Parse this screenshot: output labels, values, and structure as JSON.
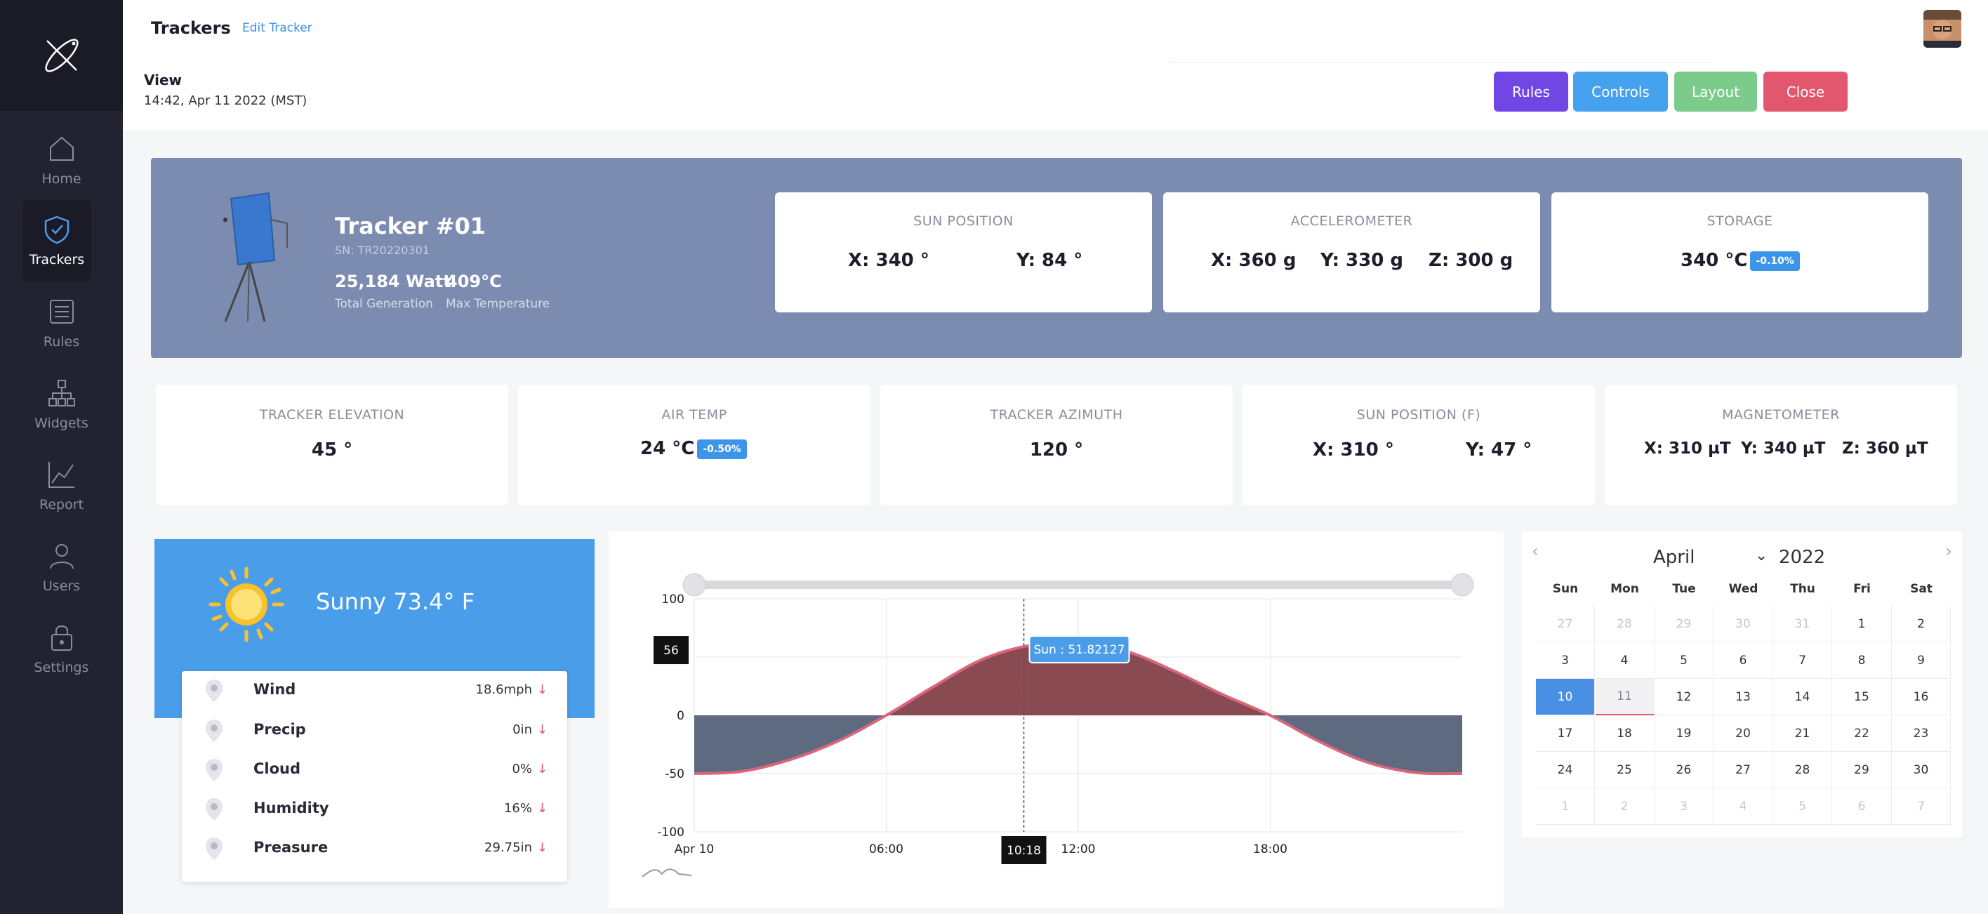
{
  "sidebar": {
    "items": [
      {
        "label": "Home",
        "icon": "home-icon"
      },
      {
        "label": "Trackers",
        "icon": "shield-check-icon"
      },
      {
        "label": "Rules",
        "icon": "list-icon"
      },
      {
        "label": "Widgets",
        "icon": "hierarchy-icon"
      },
      {
        "label": "Report",
        "icon": "trend-icon"
      },
      {
        "label": "Users",
        "icon": "user-icon"
      },
      {
        "label": "Settings",
        "icon": "lock-icon"
      }
    ],
    "active": "Trackers"
  },
  "header": {
    "title": "Trackers",
    "edit_link": "Edit Tracker",
    "view_label": "View",
    "timestamp": "14:42, Apr 11 2022 (MST)",
    "buttons": {
      "rules": "Rules",
      "controls": "Controls",
      "layout": "Layout",
      "close": "Close"
    }
  },
  "tracker": {
    "name": "Tracker #01",
    "serial": "SN: TR20220301",
    "generation": "25,184 Watt",
    "max_temp": "409°C",
    "generation_label": "Total Generation",
    "max_temp_label": "Max Temperature"
  },
  "top_cards": {
    "sun_position": {
      "title": "SUN POSITION",
      "x": "X:  340 °",
      "y": "Y:  84 °"
    },
    "accelerometer": {
      "title": "ACCELEROMETER",
      "x": "X: 360 g",
      "y": "Y: 330 g",
      "z": "Z: 300 g"
    },
    "storage": {
      "title": "STORAGE",
      "value": "340 °C",
      "badge": "-0.10%"
    }
  },
  "metric_cards": {
    "elevation": {
      "title": "TRACKER ELEVATION",
      "value": "45 °"
    },
    "air_temp": {
      "title": "AIR TEMP",
      "value": "24 °C",
      "badge": "-0.50%"
    },
    "azimuth": {
      "title": "TRACKER AZIMUTH",
      "value": "120 °"
    },
    "sun_position_f": {
      "title": "SUN POSITION (F)",
      "x": "X:  310 °",
      "y": "Y:  47 °"
    },
    "magnetometer": {
      "title": "MAGNETOMETER",
      "x": "X: 310 µT",
      "y": "Y: 340 µT",
      "z": "Z: 360 µT"
    }
  },
  "weather": {
    "condition": "Sunny  73.4° F",
    "rows": [
      {
        "label": "Wind",
        "value": "18.6mph"
      },
      {
        "label": "Precip",
        "value": "0in"
      },
      {
        "label": "Cloud",
        "value": "0%"
      },
      {
        "label": "Humidity",
        "value": "16%"
      },
      {
        "label": "Preasure",
        "value": "29.75in"
      }
    ]
  },
  "chart_data": {
    "type": "area",
    "series": [
      {
        "name": "Sun",
        "values": [
          -50,
          -48,
          -38,
          -22,
          0,
          25,
          48,
          60,
          62,
          55,
          38,
          18,
          0,
          -22,
          -40,
          -49,
          -50
        ]
      }
    ],
    "x": [
      "00:00",
      "01:30",
      "03:00",
      "04:30",
      "06:00",
      "07:30",
      "09:00",
      "10:30",
      "12:00",
      "13:30",
      "15:00",
      "16:30",
      "18:00",
      "19:30",
      "21:00",
      "22:30",
      "24:00"
    ],
    "x_tick_labels": [
      "Apr 10",
      "06:00",
      "12:00",
      "18:00"
    ],
    "y_tick_labels": [
      "100",
      "0",
      "-50",
      "-100"
    ],
    "ylim": [
      -100,
      100
    ],
    "cursor": {
      "time_label": "10:18",
      "y_label": "56",
      "tooltip": "Sun : 51.82127"
    },
    "positive_color": "#8a4a52",
    "negative_color": "#5e6a80",
    "line_color": "#d9667a",
    "grid": true
  },
  "calendar": {
    "month": "April",
    "year": "2022",
    "weekdays": [
      "Sun",
      "Mon",
      "Tue",
      "Wed",
      "Thu",
      "Fri",
      "Sat"
    ],
    "weeks": [
      [
        "27",
        "28",
        "29",
        "30",
        "31",
        "1",
        "2"
      ],
      [
        "3",
        "4",
        "5",
        "6",
        "7",
        "8",
        "9"
      ],
      [
        "10",
        "11",
        "12",
        "13",
        "14",
        "15",
        "16"
      ],
      [
        "17",
        "18",
        "19",
        "20",
        "21",
        "22",
        "23"
      ],
      [
        "24",
        "25",
        "26",
        "27",
        "28",
        "29",
        "30"
      ],
      [
        "1",
        "2",
        "3",
        "4",
        "5",
        "6",
        "7"
      ]
    ],
    "selected": "10",
    "today": "11"
  }
}
